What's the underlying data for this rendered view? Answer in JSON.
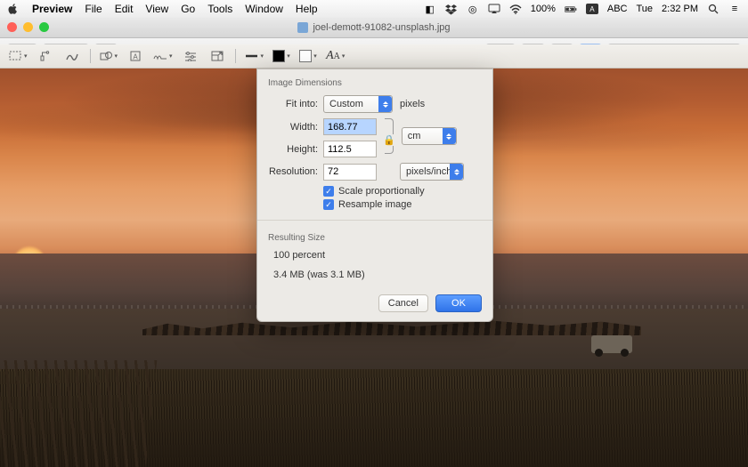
{
  "menubar": {
    "app": "Preview",
    "items": [
      "File",
      "Edit",
      "View",
      "Go",
      "Tools",
      "Window",
      "Help"
    ],
    "right": {
      "wifi": "wifi-icon",
      "battery_pct": "100%",
      "battery_icon": "battery-charging-icon",
      "input_label": "ABC",
      "day": "Tue",
      "time": "2:32 PM"
    }
  },
  "window": {
    "title": "joel-demott-91082-unsplash.jpg"
  },
  "toolbar": {
    "search_placeholder": "Search"
  },
  "dialog": {
    "header": "Image Dimensions",
    "fit_into_label": "Fit into:",
    "fit_into_value": "Custom",
    "fit_into_unit": "pixels",
    "width_label": "Width:",
    "width_value": "168.77",
    "height_label": "Height:",
    "height_value": "112.5",
    "unit_value": "cm",
    "resolution_label": "Resolution:",
    "resolution_value": "72",
    "resolution_unit": "pixels/inch",
    "scale_label": "Scale proportionally",
    "resample_label": "Resample image",
    "result_header": "Resulting Size",
    "result_pct": "100 percent",
    "result_size": "3.4 MB (was 3.1 MB)",
    "cancel": "Cancel",
    "ok": "OK"
  }
}
